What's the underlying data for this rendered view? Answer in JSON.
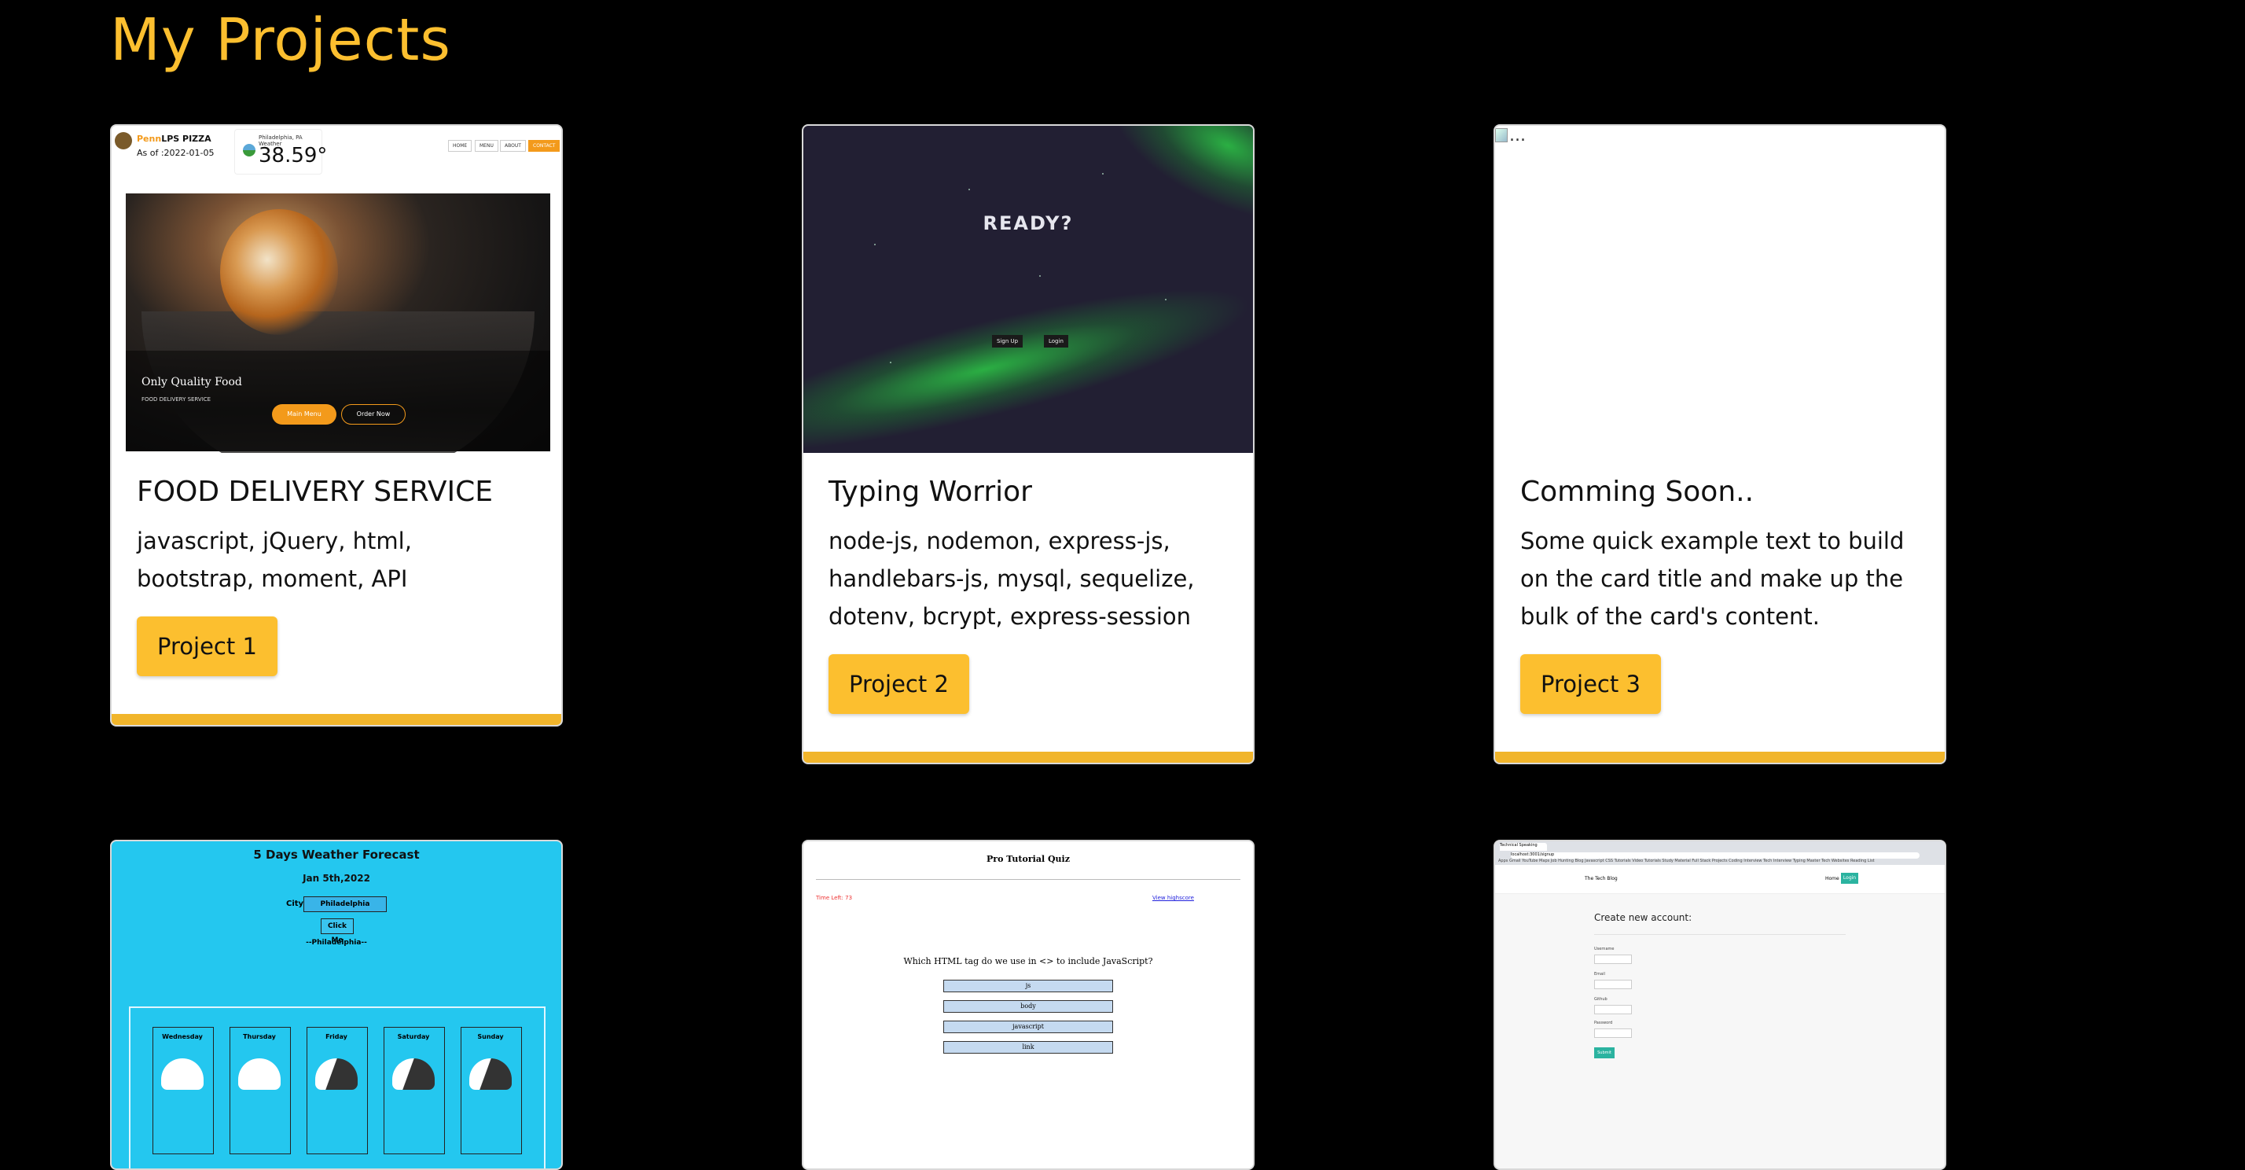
{
  "page": {
    "title": "My Projects"
  },
  "cards": [
    {
      "title": "FOOD DELIVERY SERVICE",
      "text": "javascript, jQuery, html, bootstrap, moment, API",
      "button": "Project 1",
      "thumb": {
        "brand_prefix": "Penn",
        "brand": "LPS PIZZA",
        "as_of": "As of :2022-01-05",
        "weather_location": "Philadelphia, PA Weather",
        "temperature": "38.59°",
        "nav": [
          "HOME",
          "MENU",
          "ABOUT",
          "CONTACT"
        ],
        "hero_text": "Only Quality Food",
        "hero_sub": "FOOD DELIVERY SERVICE",
        "btn_menu": "Main Menu",
        "btn_order": "Order Now"
      }
    },
    {
      "title": "Typing Worrior",
      "text": "node-js, nodemon, express-js, handlebars-js, mysql, sequelize, dotenv, bcrypt, express-session",
      "button": "Project 2",
      "thumb": {
        "ready": "READY?",
        "signup": "Sign Up",
        "login": "Login"
      }
    },
    {
      "title": "Comming Soon..",
      "text": "Some quick example text to build on the card title and make up the bulk of the card's content.",
      "button": "Project 3",
      "thumb": {
        "alt": "..."
      }
    },
    {
      "thumb": {
        "title": "5 Days Weather Forecast",
        "date": "Jan 5th,2022",
        "city_label": "City:",
        "city_value": "Philadelphia",
        "click_label": "Click Me",
        "city_result": "--Philadelphia--",
        "days": [
          "Wednesday",
          "Thursday",
          "Friday",
          "Saturday",
          "Sunday"
        ]
      }
    },
    {
      "thumb": {
        "title": "Pro Tutorial Quiz",
        "time_left": "Time Left: 73",
        "view_highscore": "View highscore",
        "question": "Which HTML tag do we use in <> to include JavaScript?",
        "options": [
          "js",
          "body",
          "javascript",
          "link"
        ]
      }
    },
    {
      "thumb": {
        "tab": "Technical Speaking",
        "url": "localhost:3001/signup",
        "bookmarks": "Apps  Gmail  YouTube  Maps  Job Hunting Blog  Javascript  CSS Tutorials  Video Tutorials  Study Material  Full Stack Projects  Coding Interview  Tech Interview  Typing Master  Tech Websites  Reading List",
        "blog_name": "The Tech Blog",
        "home": "Home",
        "login": "Login",
        "heading": "Create new account:",
        "labels": [
          "Username",
          "Email",
          "Github",
          "Password"
        ],
        "submit": "Submit"
      }
    }
  ],
  "colors": {
    "accent": "#fcbf2f",
    "background": "#000000",
    "card_bar": "#f1b52b"
  }
}
